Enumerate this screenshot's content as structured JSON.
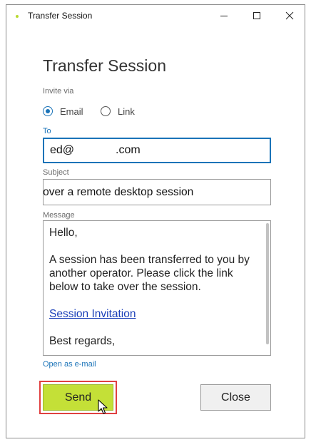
{
  "window": {
    "title": "Transfer Session",
    "controls": [
      "minimize",
      "maximize",
      "close"
    ]
  },
  "page": {
    "heading": "Transfer Session",
    "invite_label": "Invite via",
    "invite_options": [
      {
        "label": "Email",
        "selected": true
      },
      {
        "label": "Link",
        "selected": false
      }
    ],
    "to_label": "To",
    "to_value_prefix": "ed@",
    "to_value_suffix": ".com",
    "subject_label": "Subject",
    "subject_value": "Invitation to take over a remote desktop session",
    "message_label": "Message",
    "message": {
      "greeting": "Hello,",
      "body": "A session has been transferred to you by another operator. Please click the link below to take over the session.",
      "link_text": "Session Invitation",
      "closing": "Best regards,"
    },
    "open_as_email": "Open as e-mail",
    "send_label": "Send",
    "close_label": "Close"
  },
  "colors": {
    "accent": "#1a73b8",
    "send_button": "#c4e037",
    "highlight_outline": "#e04040"
  }
}
